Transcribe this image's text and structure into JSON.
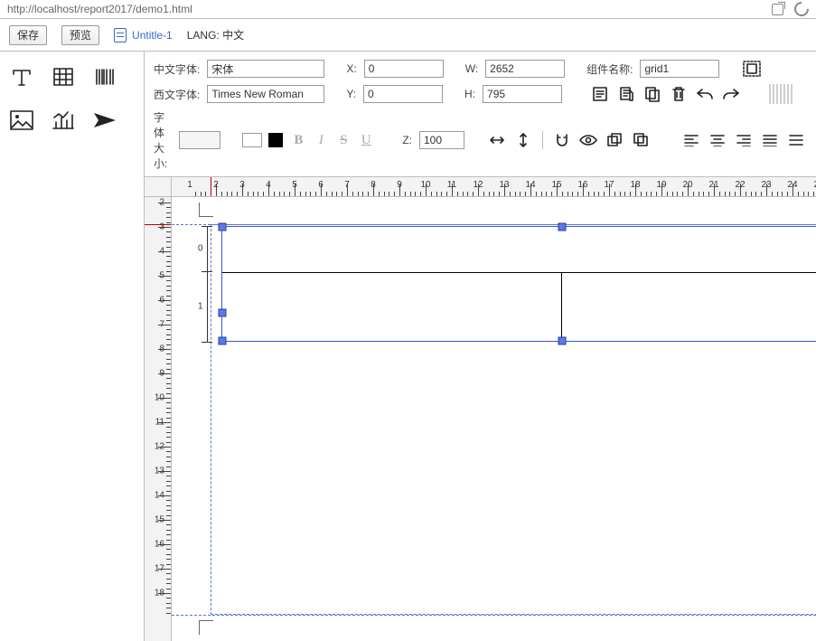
{
  "header": {
    "addr": "http://localhost/report2017/demo1.html"
  },
  "bar1": {
    "save": "保存",
    "preview": "预览",
    "doc": "Untitle-1",
    "lang_label": "LANG:",
    "lang_value": "中文"
  },
  "props": {
    "font_cn_label": "中文字体:",
    "font_cn": "宋体",
    "font_en_label": "西文字体:",
    "font_en": "Times New Roman",
    "font_size_label": "字体大小:",
    "font_size": "",
    "x_label": "X:",
    "x": "0",
    "y_label": "Y:",
    "y": "0",
    "z_label": "Z:",
    "z": "100",
    "w_label": "W:",
    "w": "2652",
    "h_label": "H:",
    "h": "795",
    "comp_label": "组件名称:",
    "comp": "grid1"
  }
}
